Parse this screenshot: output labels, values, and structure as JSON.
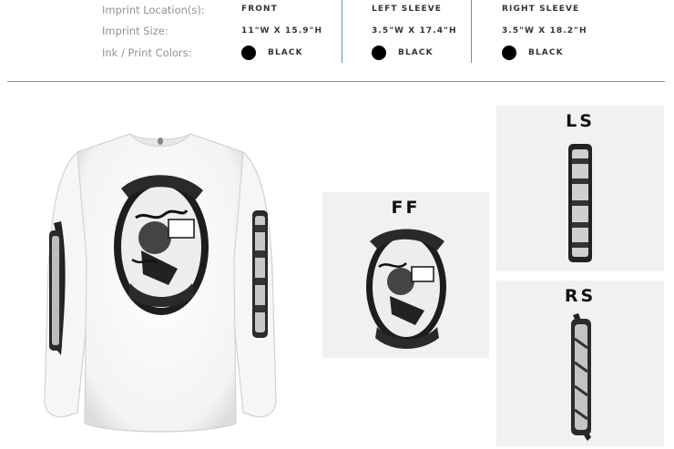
{
  "specs": {
    "labels": {
      "location": "Imprint Location(s):",
      "size": "Imprint Size:",
      "ink": "Ink / Print Colors:"
    },
    "columns": [
      {
        "location": "FRONT",
        "size": "11\"W X 15.9\"H",
        "ink": "BLACK"
      },
      {
        "location": "LEFT SLEEVE",
        "size": "3.5\"W X 17.4\"H",
        "ink": "BLACK"
      },
      {
        "location": "RIGHT SLEEVE",
        "size": "3.5\"W X 18.2\"H",
        "ink": "BLACK"
      }
    ],
    "ink_color": "#000000"
  },
  "panels": {
    "front": {
      "title": "FF"
    },
    "left_sleeve": {
      "title": "LS"
    },
    "right_sleeve": {
      "title": "RS"
    }
  },
  "colors": {
    "accent_rule": "#5b8fd6",
    "panel_bg": "#f1f1f4",
    "label_gray": "#8e929a"
  }
}
